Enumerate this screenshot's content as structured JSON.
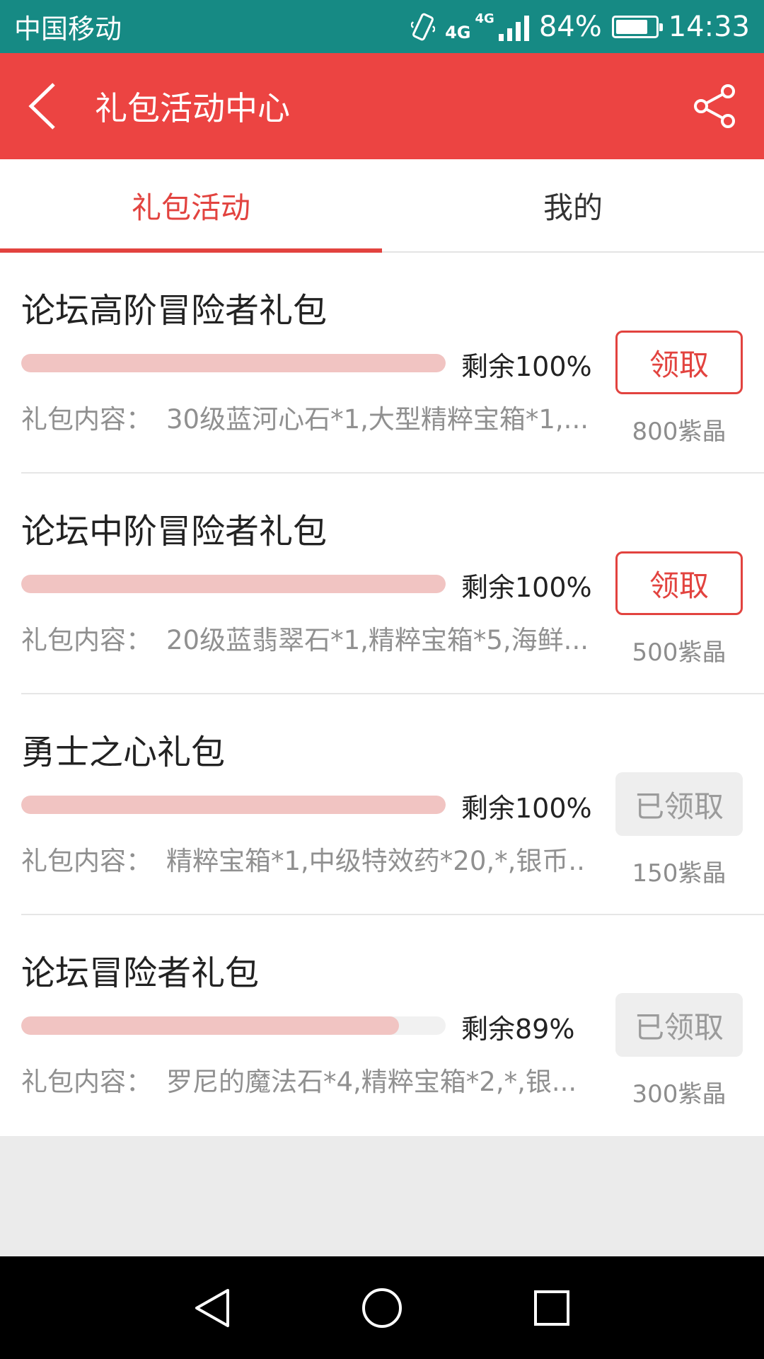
{
  "status_bar": {
    "carrier": "中国移动",
    "network": "4G",
    "network_small": "4G",
    "battery": "84%",
    "battery_level": 0.84,
    "time": "14:33"
  },
  "header": {
    "title": "礼包活动中心",
    "back_icon": "chevron-left-icon",
    "share_icon": "share-icon"
  },
  "tabs": [
    {
      "label": "礼包活动",
      "active": true
    },
    {
      "label": "我的",
      "active": false
    }
  ],
  "gifts": [
    {
      "title": "论坛高阶冒险者礼包",
      "remaining_text": "剩余100%",
      "remaining_fraction": 1.0,
      "content_label": "礼包内容：",
      "content": "30级蓝河心石*1,大型精粹宝箱*1,...",
      "button_label": "领取",
      "claimed": false,
      "price": "800紫晶"
    },
    {
      "title": "论坛中阶冒险者礼包",
      "remaining_text": "剩余100%",
      "remaining_fraction": 1.0,
      "content_label": "礼包内容：",
      "content": "20级蓝翡翠石*1,精粹宝箱*5,海鲜...",
      "button_label": "领取",
      "claimed": false,
      "price": "500紫晶"
    },
    {
      "title": "勇士之心礼包",
      "remaining_text": "剩余100%",
      "remaining_fraction": 1.0,
      "content_label": "礼包内容：",
      "content": "精粹宝箱*1,中级特效药*20,*,银币...",
      "button_label": "已领取",
      "claimed": true,
      "price": "150紫晶"
    },
    {
      "title": "论坛冒险者礼包",
      "remaining_text": "剩余89%",
      "remaining_fraction": 0.89,
      "content_label": "礼包内容：",
      "content": "罗尼的魔法石*4,精粹宝箱*2,*,银...",
      "button_label": "已领取",
      "claimed": true,
      "price": "300紫晶"
    }
  ],
  "nav_bar": {
    "icons": [
      "back-triangle-icon",
      "home-circle-icon",
      "recents-square-icon"
    ]
  },
  "colors": {
    "status_bar": "#168a84",
    "header": "#ec4442",
    "accent": "#e2433f",
    "progress": "#f1c4c2"
  }
}
